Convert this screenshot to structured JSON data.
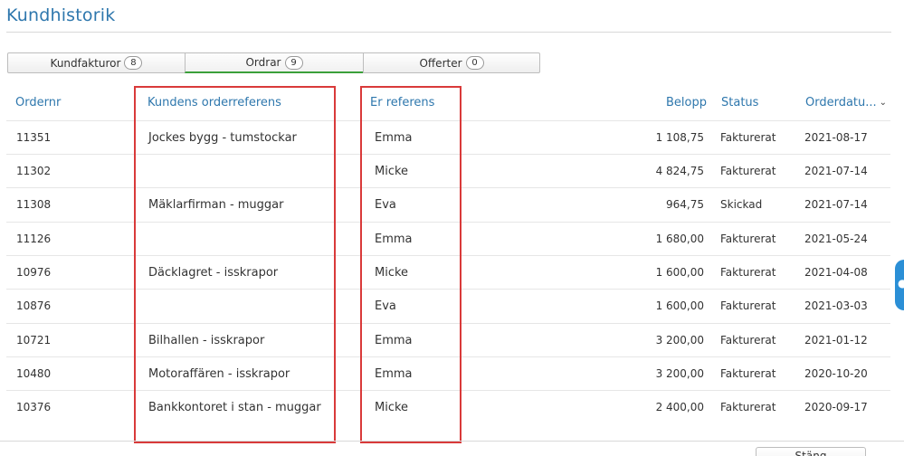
{
  "page": {
    "title": "Kundhistorik"
  },
  "tabs": [
    {
      "label": "Kundfakturor",
      "count": "8",
      "active": false
    },
    {
      "label": "Ordrar",
      "count": "9",
      "active": true
    },
    {
      "label": "Offerter",
      "count": "0",
      "active": false
    }
  ],
  "table": {
    "headers": {
      "ordernr": "Ordernr",
      "kundref": "Kundens orderreferens",
      "erref": "Er referens",
      "belopp": "Belopp",
      "status": "Status",
      "orderdatum": "Orderdatu..."
    },
    "rows": [
      {
        "ordernr": "11351",
        "kundref": "Jockes bygg - tumstockar",
        "erref": "Emma",
        "belopp": "1 108,75",
        "status": "Fakturerat",
        "datum": "2021-08-17"
      },
      {
        "ordernr": "11302",
        "kundref": "",
        "erref": "Micke",
        "belopp": "4 824,75",
        "status": "Fakturerat",
        "datum": "2021-07-14"
      },
      {
        "ordernr": "11308",
        "kundref": "Mäklarfirman - muggar",
        "erref": "Eva",
        "belopp": "964,75",
        "status": "Skickad",
        "datum": "2021-07-14"
      },
      {
        "ordernr": "11126",
        "kundref": "",
        "erref": "Emma",
        "belopp": "1 680,00",
        "status": "Fakturerat",
        "datum": "2021-05-24"
      },
      {
        "ordernr": "10976",
        "kundref": "Däcklagret - isskrapor",
        "erref": "Micke",
        "belopp": "1 600,00",
        "status": "Fakturerat",
        "datum": "2021-04-08"
      },
      {
        "ordernr": "10876",
        "kundref": "",
        "erref": "Eva",
        "belopp": "1 600,00",
        "status": "Fakturerat",
        "datum": "2021-03-03"
      },
      {
        "ordernr": "10721",
        "kundref": "Bilhallen - isskrapor",
        "erref": "Emma",
        "belopp": "3 200,00",
        "status": "Fakturerat",
        "datum": "2021-01-12"
      },
      {
        "ordernr": "10480",
        "kundref": "Motoraffären - isskrapor",
        "erref": "Emma",
        "belopp": "3 200,00",
        "status": "Fakturerat",
        "datum": "2020-10-20"
      },
      {
        "ordernr": "10376",
        "kundref": "Bankkontoret i stan - muggar",
        "erref": "Micke",
        "belopp": "2 400,00",
        "status": "Fakturerat",
        "datum": "2020-09-17"
      }
    ]
  },
  "footer": {
    "close_label": "Stäng"
  },
  "colors": {
    "accent": "#2e77ad",
    "active_tab": "#3ba03a",
    "highlight_box": "#d93a3a"
  }
}
